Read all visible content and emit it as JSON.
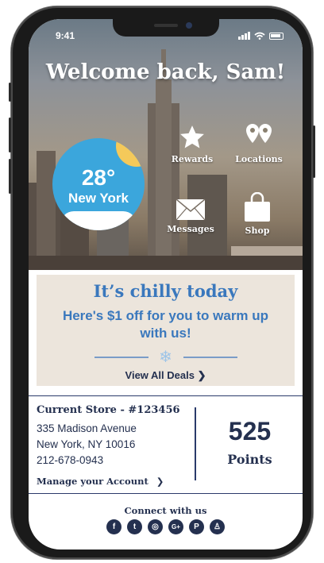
{
  "status_bar": {
    "time": "9:41"
  },
  "hero": {
    "welcome": "Welcome back, Sam!",
    "weather": {
      "temperature": "28°",
      "city": "New York"
    },
    "tiles": [
      {
        "label": "Rewards",
        "icon": "star-icon"
      },
      {
        "label": "Locations",
        "icon": "map-pin-icon"
      },
      {
        "label": "Messages",
        "icon": "envelope-icon"
      },
      {
        "label": "Shop",
        "icon": "shopping-bag-icon"
      }
    ]
  },
  "deal": {
    "headline": "It’s chilly today",
    "body": "Here's $1 off for you to warm up with us!",
    "link": "View All Deals",
    "icon": "snowflake-icon"
  },
  "store": {
    "title": "Current Store - #123456",
    "address_line1": "335 Madison Avenue",
    "address_line2": "New York, NY 10016",
    "phone": "212-678-0943",
    "manage": "Manage your Account",
    "points_value": "525",
    "points_label": "Points"
  },
  "connect": {
    "label": "Connect with us",
    "socials": [
      {
        "name": "facebook-icon",
        "glyph": "f"
      },
      {
        "name": "twitter-icon",
        "glyph": "t"
      },
      {
        "name": "instagram-icon",
        "glyph": "◎"
      },
      {
        "name": "google-plus-icon",
        "glyph": "G+"
      },
      {
        "name": "pinterest-icon",
        "glyph": "P"
      },
      {
        "name": "snapchat-icon",
        "glyph": "♙"
      }
    ]
  },
  "colors": {
    "brand_blue": "#3a78bd",
    "navy": "#24304f",
    "deal_bg": "#ece5dc",
    "weather_blue": "#3ba6dc",
    "sun_yellow": "#f4c95a"
  }
}
